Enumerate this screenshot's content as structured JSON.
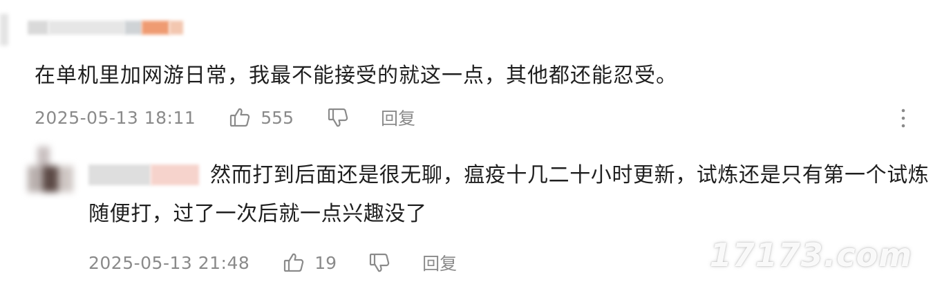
{
  "comment": {
    "text": "在单机里加网游日常，我最不能接受的就这一点，其他都还能忍受。",
    "date": "2025-05-13 18:11",
    "likes": "555",
    "reply_label": "回复",
    "icons": {
      "like": "thumbs-up-icon",
      "dislike": "thumbs-down-icon",
      "more": "more-vertical-icon"
    }
  },
  "reply": {
    "text": "然而打到后面还是很无聊，瘟疫十几二十小时更新，试炼还是只有第一个试炼随便打，过了一次后就一点兴趣没了",
    "date": "2025-05-13 21:48",
    "likes": "19",
    "reply_label": "回复"
  },
  "watermark": "17173.com",
  "colors": {
    "text": "#1f1f1f",
    "meta": "#8a8a8a",
    "name_accent": "#f0a07a"
  }
}
